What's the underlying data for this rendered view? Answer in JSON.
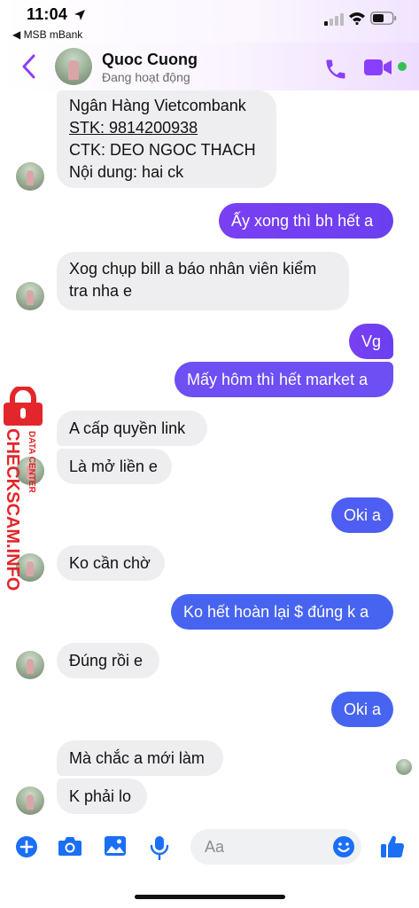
{
  "status_bar": {
    "time": "11:04",
    "back_app": "◀ MSB mBank",
    "icons": [
      "location-arrow-icon",
      "cellular-signal-icon",
      "wifi-icon",
      "battery-icon"
    ]
  },
  "header": {
    "contact_name": "Quoc Cuong",
    "contact_status": "Đang hoạt động",
    "accent_color": "#8a3ffc",
    "online_color": "#31c24d"
  },
  "messages": [
    {
      "from": "them",
      "lines": [
        "Ngân Hàng Vietcombank",
        "STK: 9814200938",
        "CTK: DEO NGOC THACH",
        "Nội dung: hai ck"
      ]
    },
    {
      "from": "me",
      "lines": [
        "Ấy xong thì bh hết a"
      ]
    },
    {
      "from": "them",
      "lines": [
        "Xog chụp bill a báo nhân viên kiểm",
        "tra nha e"
      ]
    },
    {
      "from": "me",
      "lines": [
        "Vg"
      ]
    },
    {
      "from": "me",
      "lines": [
        "Mấy hôm thì hết market a"
      ]
    },
    {
      "from": "them",
      "lines": [
        "A cấp quyền link"
      ]
    },
    {
      "from": "them",
      "lines": [
        "Là mở liền e"
      ]
    },
    {
      "from": "me",
      "lines": [
        "Oki a"
      ]
    },
    {
      "from": "them",
      "lines": [
        "Ko cần chờ"
      ]
    },
    {
      "from": "me",
      "lines": [
        "Ko hết hoàn lại $ đúng k a"
      ]
    },
    {
      "from": "them",
      "lines": [
        "Đúng rồi e"
      ]
    },
    {
      "from": "me",
      "lines": [
        "Oki a"
      ]
    },
    {
      "from": "them",
      "lines": [
        "Mà chắc a mới làm"
      ]
    },
    {
      "from": "them",
      "lines": [
        "K phải lo"
      ]
    }
  ],
  "watermark": {
    "brand": "CHECKSCAM.INFO",
    "sub": "DATA CENTER",
    "color": "#e3262b"
  },
  "composer": {
    "placeholder": "Aa",
    "icons": [
      "plus-icon",
      "camera-icon",
      "gallery-icon",
      "microphone-icon",
      "emoji-icon",
      "thumbs-up-icon"
    ],
    "icon_color": "#1a6ff5"
  }
}
